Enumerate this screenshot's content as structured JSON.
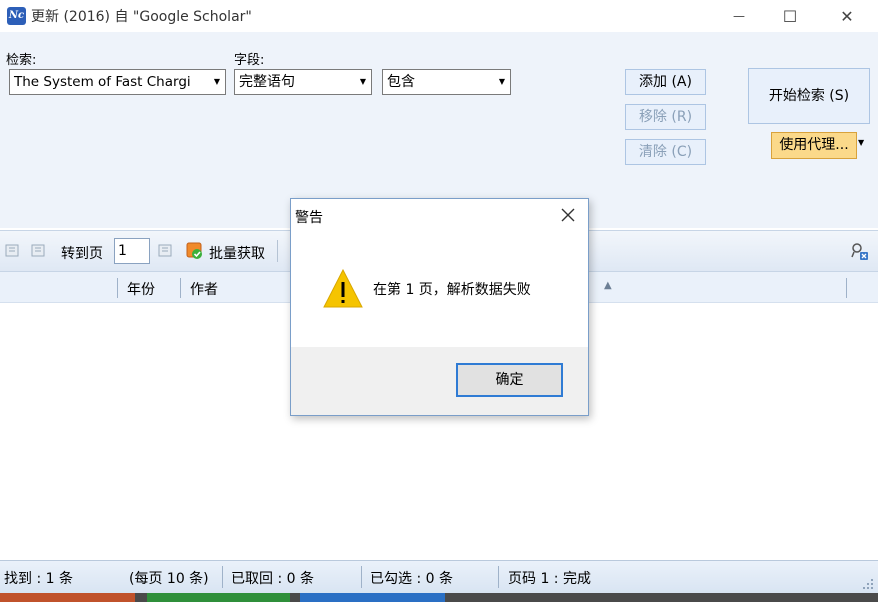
{
  "window": {
    "title": "更新 (2016) 自 \"Google Scholar\"",
    "app_icon_text": "Nc",
    "minimize_glyph": "—",
    "maximize_glyph": "☐",
    "close_glyph": "✕"
  },
  "search": {
    "search_label": "检索:",
    "field_label": "字段:",
    "query_value": "The System of Fast Chargi",
    "field_value": "完整语句",
    "condition_value": "包含",
    "add_button": "添加 (A)",
    "remove_button": "移除 (R)",
    "clear_button": "清除 (C)",
    "start_button": "开始检索 (S)",
    "proxy_button": "使用代理..."
  },
  "toolbar": {
    "goto_label": "转到页",
    "page_value": "1",
    "batch_label": "批量获取"
  },
  "table": {
    "columns": [
      "年份",
      "作者"
    ]
  },
  "status": {
    "found": "找到 : 1 条",
    "per_page": "(每页 10 条)",
    "retrieved": "已取回 : 0 条",
    "checked": "已勾选 : 0 条",
    "page_status": "页码 1 : 完成"
  },
  "dialog": {
    "title": "警告",
    "message": "在第 1 页，解析数据失败",
    "ok_button": "确定"
  },
  "colors": {
    "accent": "#2f7bd4",
    "warning": "#f5c400",
    "proxy": "#fbd98a"
  }
}
